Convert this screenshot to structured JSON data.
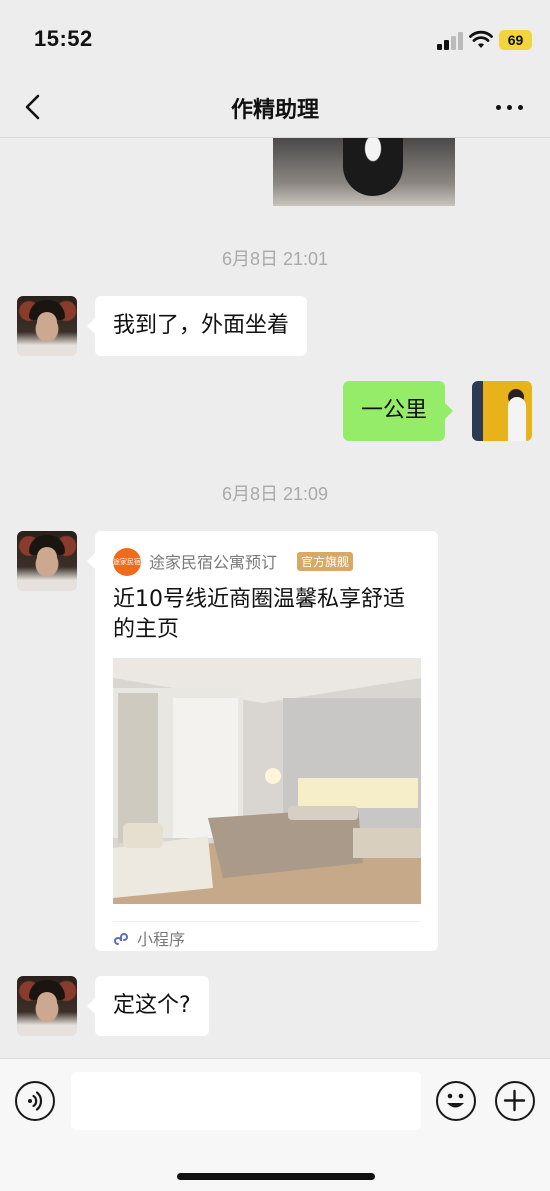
{
  "status_bar": {
    "time": "15:52",
    "battery": "69",
    "battery_color": "#f2d43d"
  },
  "nav": {
    "title": "作精助理",
    "back_icon": "chevron-left-icon",
    "more_icon": "more-dots-icon"
  },
  "messages": {
    "time_1": "6月8日 21:01",
    "msg_1": "我到了，外面坐着",
    "msg_2": "一公里",
    "time_2": "6月8日 21:09",
    "card": {
      "logo_text": "途家民宿",
      "source": "途家民宿公寓预订",
      "badge": "官方旗舰",
      "title": "近10号线近商圈温馨私享舒适的主页",
      "footer_label": "小程序"
    },
    "msg_3": "定这个?"
  },
  "input_bar": {
    "voice_icon": "voice-icon",
    "emoji_icon": "emoji-icon",
    "plus_icon": "plus-icon",
    "input_value": ""
  },
  "colors": {
    "background": "#ededed",
    "outgoing_bubble": "#95ec69",
    "incoming_bubble": "#ffffff",
    "badge": "#d8a867",
    "logo": "#f26a1b"
  }
}
